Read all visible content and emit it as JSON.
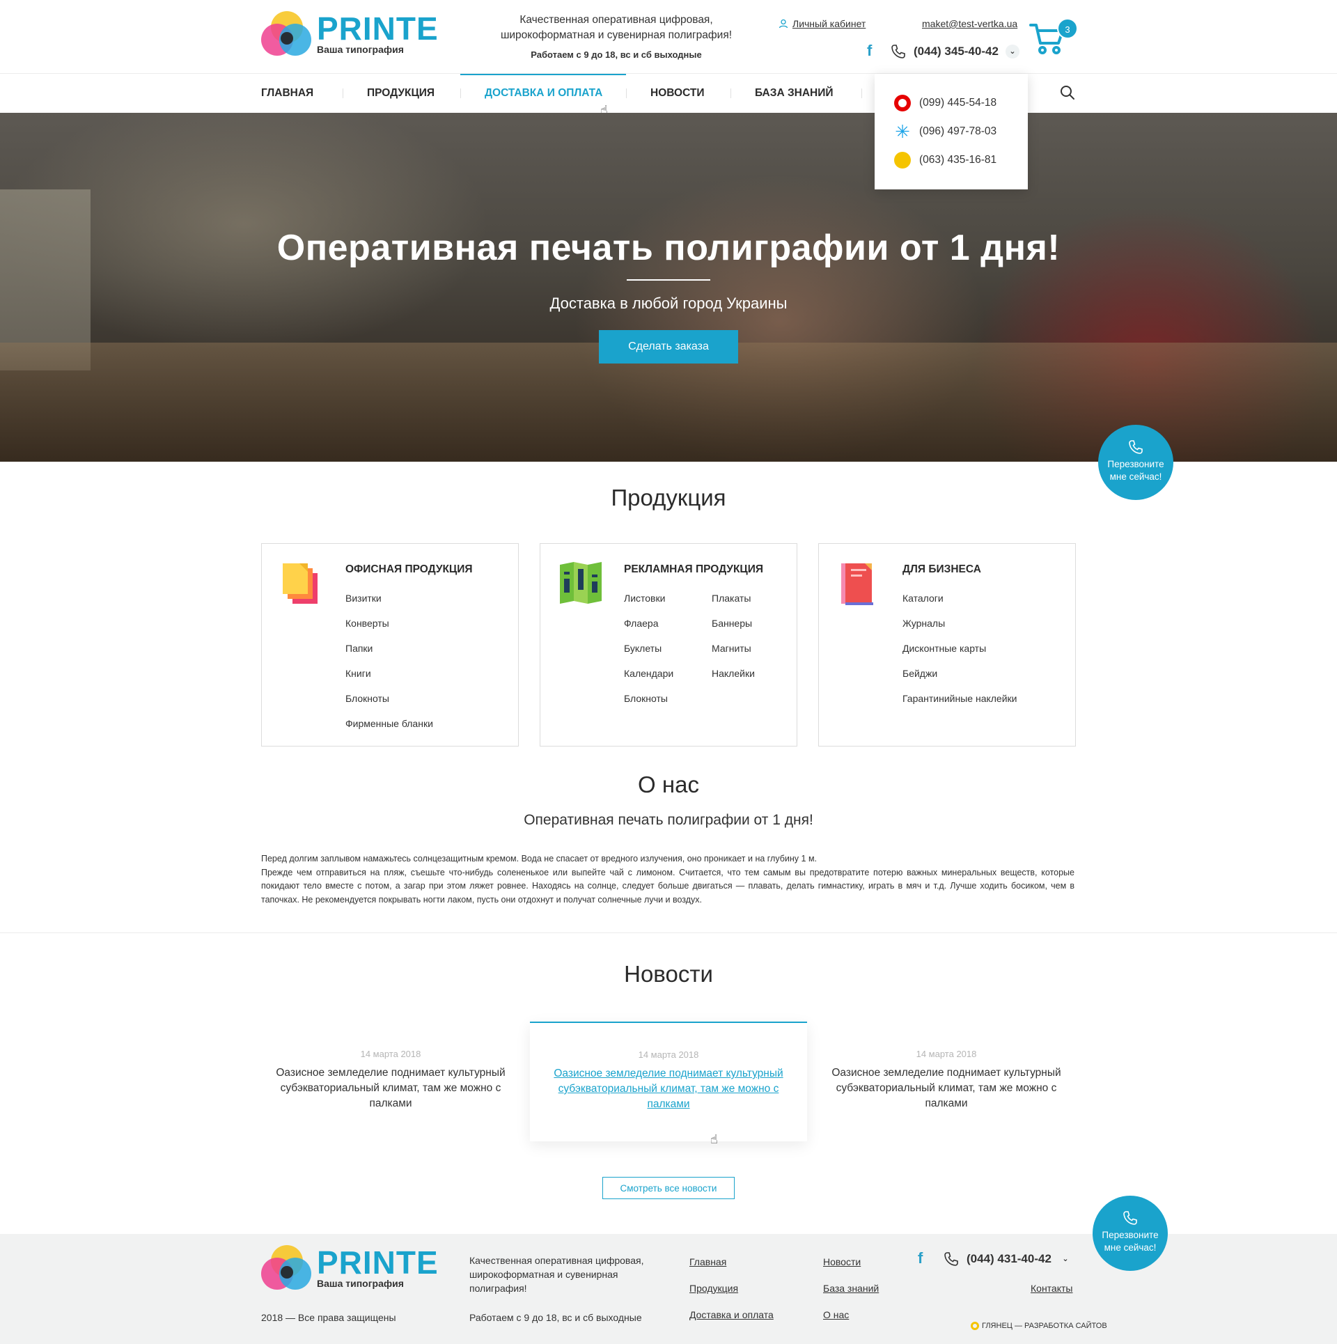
{
  "header": {
    "logo_title": "PRINTE",
    "logo_sub": "Ваша типография",
    "tagline": "Качественная оперативная цифровая, широкоформатная и сувенирная полиграфия!",
    "hours": "Работаем с 9 до 18, вс и сб выходные",
    "cabinet": "Личный кабинет",
    "email": "maket@test-vertka.ua",
    "phone": "(044) 345-40-42",
    "cart_count": "3",
    "facebook": "f"
  },
  "phone_dropdown": [
    {
      "operator_icon": "vodafone-icon",
      "number": "(099) 445-54-18"
    },
    {
      "operator_icon": "kyivstar-icon",
      "number": "(096) 497-78-03"
    },
    {
      "operator_icon": "lifecell-icon",
      "number": "(063) 435-16-81"
    }
  ],
  "nav": {
    "items": [
      "ГЛАВНАЯ",
      "ПРОДУКЦИЯ",
      "ДОСТАВКА И ОПЛАТА",
      "НОВОСТИ",
      "БАЗА ЗНАНИЙ"
    ],
    "active_index": 2
  },
  "hero": {
    "title": "Оперативная печать полиграфии от 1 дня!",
    "subtitle": "Доставка в любой город Украины",
    "button": "Сделать заказа"
  },
  "callback": {
    "label_line1": "Перезвоните",
    "label_line2": "мне сейчас!"
  },
  "products": {
    "title": "Продукция",
    "cards": [
      {
        "title": "ОФИСНАЯ ПРОДУКЦИЯ",
        "icon": "office-docs-icon",
        "col1": [
          "Визитки",
          "Конверты",
          "Папки",
          "Книги",
          "Блокноты",
          "Фирменные бланки"
        ],
        "col2": []
      },
      {
        "title": "РЕКЛАМНАЯ ПРОДУКЦИЯ",
        "icon": "brochure-icon",
        "col1": [
          "Листовки",
          "Флаера",
          "Буклеты",
          "Календари",
          "Блокноты"
        ],
        "col2": [
          "Плакаты",
          "Баннеры",
          "Магниты",
          "Наклейки"
        ]
      },
      {
        "title": "ДЛЯ БИЗНЕСА",
        "icon": "catalog-book-icon",
        "col1": [
          "Каталоги",
          "Журналы",
          "Дисконтные карты",
          "Бейджи",
          "Гарантинийные наклейки"
        ],
        "col2": []
      }
    ]
  },
  "about": {
    "title": "О нас",
    "subtitle": "Оперативная печать полиграфии от 1 дня!",
    "text_line1": "Перед долгим заплывом намажьтесь солнцезащитным кремом. Вода не спасает от вредного излучения, оно проникает и на глубину 1 м.",
    "text_line2": "Прежде чем отправиться на пляж, съешьте что-нибудь солененькое или выпейте чай с лимоном. Считается, что тем самым вы предотвратите потерю важных минеральных веществ, которые покидают тело вместе с потом, а загар при этом ляжет ровнее. Находясь на солнце, следует больше двигаться — плавать, делать гимнастику, играть в мяч и т.д. Лучше ходить босиком, чем в тапочках. Не рекомендуется покрывать ногти лаком, пусть они отдохнут и получат солнечные лучи и воздух."
  },
  "news": {
    "title": "Новости",
    "items": [
      {
        "date": "14 марта 2018",
        "text": "Оазисное земледелие поднимает культурный субэкваториальный климат, там же можно с палками"
      },
      {
        "date": "14 марта 2018",
        "text": "Оазисное земледелие поднимает культурный субэкваториальный климат, там же можно с палками"
      },
      {
        "date": "14 марта 2018",
        "text": "Оазисное земледелие поднимает культурный субэкваториальный климат, там же можно с палками"
      }
    ],
    "all_button": "Смотреть все новости"
  },
  "footer": {
    "tagline": "Качественная оперативная цифровая, широкоформатная и сувенирная полиграфия!",
    "hours": "Работаем с 9 до 18, вс и сб выходные",
    "copyright": "2018 — Все права защищены",
    "links_col1": [
      "Главная",
      "Продукция",
      "Доставка и оплата"
    ],
    "links_col2": [
      "Новости",
      "База знаний",
      "О нас"
    ],
    "contacts": "Контакты",
    "phone": "(044) 431-40-42",
    "developer": "ГЛЯНЕЦ — РАЗРАБОТКА САЙТОВ"
  },
  "colors": {
    "accent": "#1aa3cc",
    "text": "#2b2b2b",
    "footer_bg": "#f1f2f2"
  }
}
